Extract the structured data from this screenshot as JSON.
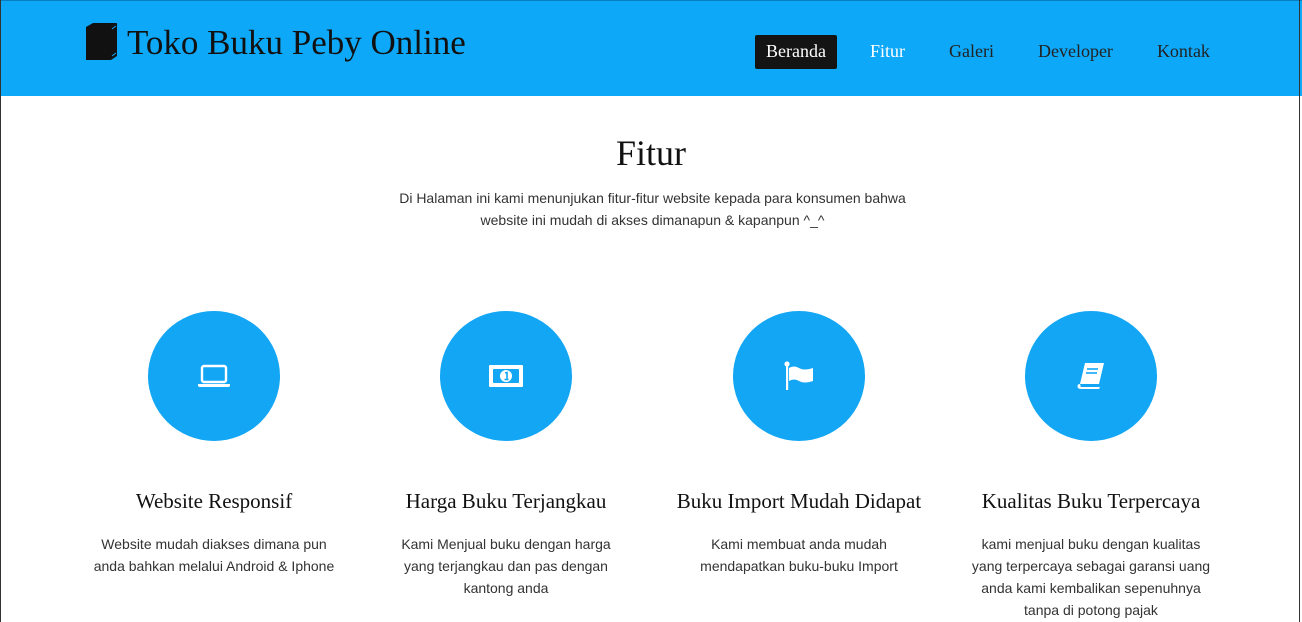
{
  "brand": {
    "title": "Toko Buku Peby Online",
    "icon": "book-icon"
  },
  "nav": {
    "items": [
      {
        "label": "Beranda"
      },
      {
        "label": "Fitur"
      },
      {
        "label": "Galeri"
      },
      {
        "label": "Developer"
      },
      {
        "label": "Kontak"
      }
    ]
  },
  "section": {
    "title": "Fitur",
    "description": "Di Halaman ini kami menunjukan fitur-fitur website kepada para konsumen bahwa website ini mudah di akses dimanapun & kapanpun ^_^"
  },
  "features": [
    {
      "icon": "laptop-icon",
      "title": "Website Responsif",
      "text": "Website mudah diakses dimana pun anda bahkan melalui Android & Iphone"
    },
    {
      "icon": "money-icon",
      "title": "Harga Buku Terjangkau",
      "text": "Kami Menjual buku dengan harga yang terjangkau dan pas dengan kantong anda"
    },
    {
      "icon": "flag-icon",
      "title": "Buku Import Mudah Didapat",
      "text": "Kami membuat anda mudah mendapatkan buku-buku Import"
    },
    {
      "icon": "book-icon",
      "title": "Kualitas Buku Terpercaya",
      "text": "kami menjual buku dengan kualitas yang terpercaya sebagai garansi uang anda kami kembalikan sepenuhnya tanpa di potong pajak"
    }
  ],
  "colors": {
    "navbar": "#0ea8f8",
    "circle": "#12a6f5",
    "active_nav": "#141414"
  }
}
